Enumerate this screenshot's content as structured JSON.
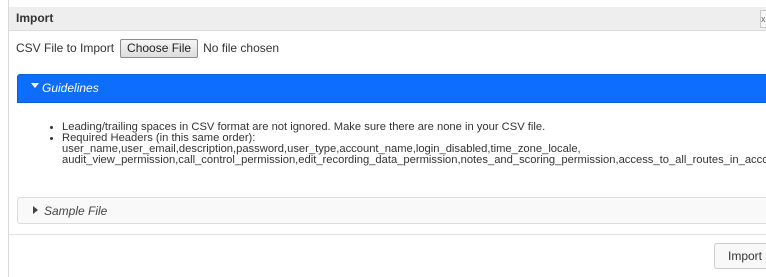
{
  "dialog": {
    "title": "Import",
    "close_label": "x"
  },
  "file_input": {
    "label": "CSV File to Import",
    "button_label": "Choose File",
    "status": "No file chosen"
  },
  "guidelines": {
    "title": "Guidelines",
    "expanded": true,
    "items": [
      "Leading/trailing spaces in CSV format are not ignored. Make sure there are none in your CSV file.",
      "Required Headers (in this same order):"
    ],
    "headers_line1": "user_name,user_email,description,password,user_type,account_name,login_disabled,time_zone_locale,",
    "headers_line2": "audit_view_permission,call_control_permission,edit_recording_data_permission,notes_and_scoring_permission,access_to_all_routes_in_account"
  },
  "sample_file": {
    "title": "Sample File",
    "expanded": false
  },
  "footer": {
    "import_label": "Import"
  },
  "colors": {
    "accent": "#0d6efd",
    "titlebar": "#eeeeee"
  }
}
